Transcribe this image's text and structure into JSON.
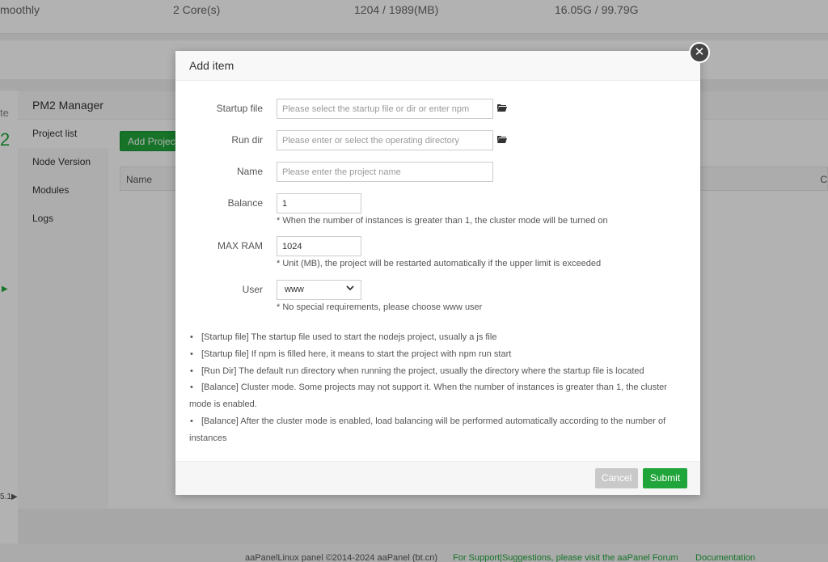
{
  "background": {
    "stats": [
      "moothly",
      "2 Core(s)",
      "1204 / 1989(MB)",
      "16.05G / 99.79G"
    ],
    "left_chars": [
      "te",
      "2",
      "▶",
      "▶",
      "5.1▶"
    ],
    "footer": {
      "copyright": "aaPanelLinux panel ©2014-2024 aaPanel (bt.cn)",
      "support": "For Support|Suggestions, please visit the aaPanel Forum",
      "docs": "Documentation"
    }
  },
  "pm2": {
    "title": "PM2 Manager",
    "sidebar": [
      "Project list",
      "Node Version",
      "Modules",
      "Logs"
    ],
    "add_button": "Add Project",
    "table_header": "Name",
    "table_header_right": "C"
  },
  "modal": {
    "title": "Add item",
    "close_icon": "close-icon",
    "fields": {
      "startup_file": {
        "label": "Startup file",
        "placeholder": "Please select the startup file or dir or enter npm",
        "icon": "folder-icon"
      },
      "run_dir": {
        "label": "Run dir",
        "placeholder": "Please enter or select the operating directory",
        "icon": "folder-icon"
      },
      "name": {
        "label": "Name",
        "placeholder": "Please enter the project name"
      },
      "balance": {
        "label": "Balance",
        "value": "1",
        "hint": "* When the number of instances is greater than 1, the cluster mode will be turned on"
      },
      "max_ram": {
        "label": "MAX RAM",
        "value": "1024",
        "hint": "* Unit (MB), the project will be restarted automatically if the upper limit is exceeded"
      },
      "user": {
        "label": "User",
        "value": "www",
        "hint": "* No special requirements, please choose www user"
      }
    },
    "notes": [
      "[Startup file] The startup file used to start the nodejs project, usually a js file",
      "[Startup file] If npm is filled here, it means to start the project with npm run start",
      "[Run Dir] The default run directory when running the project, usually the directory where the startup file is located",
      "[Balance] Cluster mode. Some projects may not support it. When the number of instances is greater than 1, the cluster mode is enabled.",
      "[Balance] After the cluster mode is enabled, load balancing will be performed automatically according to the number of instances"
    ],
    "buttons": {
      "cancel": "Cancel",
      "submit": "Submit"
    }
  },
  "colors": {
    "accent": "#20a53a",
    "cancel": "#c9c9c9"
  }
}
